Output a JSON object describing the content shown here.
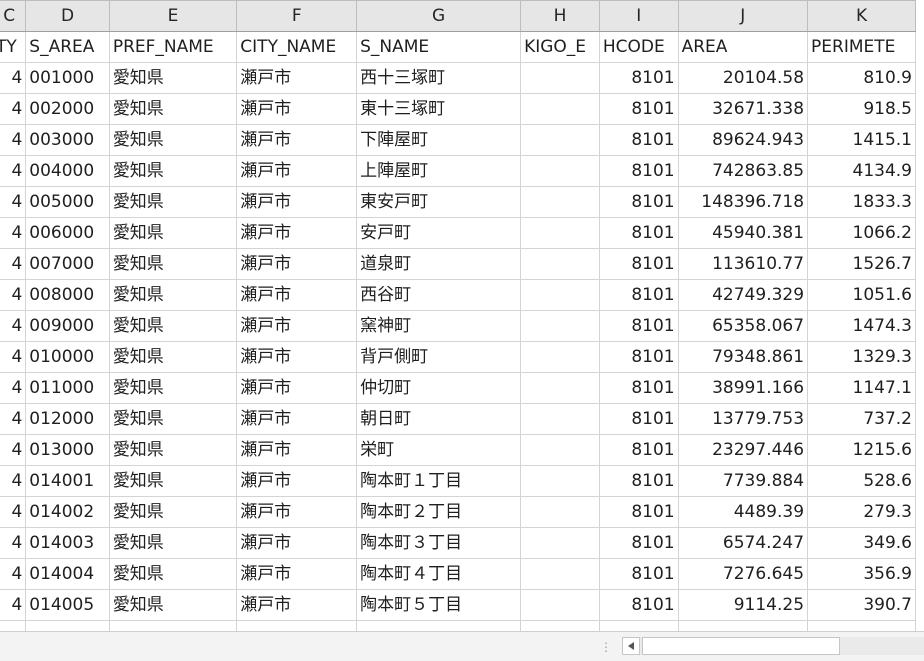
{
  "columns": [
    "C",
    "D",
    "E",
    "F",
    "G",
    "H",
    "I",
    "J",
    "K"
  ],
  "headers": [
    "TY",
    "S_AREA",
    "PREF_NAME",
    "CITY_NAME",
    "S_NAME",
    "KIGO_E",
    "HCODE",
    "AREA",
    "PERIMETE"
  ],
  "rows": [
    {
      "c": "4",
      "s_area": "001000",
      "pref": "愛知県",
      "city": "瀬戸市",
      "s_name": "西十三塚町",
      "kigo": "",
      "hcode": "8101",
      "area": "20104.58",
      "perim": "810.9"
    },
    {
      "c": "4",
      "s_area": "002000",
      "pref": "愛知県",
      "city": "瀬戸市",
      "s_name": "東十三塚町",
      "kigo": "",
      "hcode": "8101",
      "area": "32671.338",
      "perim": "918.5"
    },
    {
      "c": "4",
      "s_area": "003000",
      "pref": "愛知県",
      "city": "瀬戸市",
      "s_name": "下陣屋町",
      "kigo": "",
      "hcode": "8101",
      "area": "89624.943",
      "perim": "1415.1"
    },
    {
      "c": "4",
      "s_area": "004000",
      "pref": "愛知県",
      "city": "瀬戸市",
      "s_name": "上陣屋町",
      "kigo": "",
      "hcode": "8101",
      "area": "742863.85",
      "perim": "4134.9"
    },
    {
      "c": "4",
      "s_area": "005000",
      "pref": "愛知県",
      "city": "瀬戸市",
      "s_name": "東安戸町",
      "kigo": "",
      "hcode": "8101",
      "area": "148396.718",
      "perim": "1833.3"
    },
    {
      "c": "4",
      "s_area": "006000",
      "pref": "愛知県",
      "city": "瀬戸市",
      "s_name": "安戸町",
      "kigo": "",
      "hcode": "8101",
      "area": "45940.381",
      "perim": "1066.2"
    },
    {
      "c": "4",
      "s_area": "007000",
      "pref": "愛知県",
      "city": "瀬戸市",
      "s_name": "道泉町",
      "kigo": "",
      "hcode": "8101",
      "area": "113610.77",
      "perim": "1526.7"
    },
    {
      "c": "4",
      "s_area": "008000",
      "pref": "愛知県",
      "city": "瀬戸市",
      "s_name": "西谷町",
      "kigo": "",
      "hcode": "8101",
      "area": "42749.329",
      "perim": "1051.6"
    },
    {
      "c": "4",
      "s_area": "009000",
      "pref": "愛知県",
      "city": "瀬戸市",
      "s_name": "窯神町",
      "kigo": "",
      "hcode": "8101",
      "area": "65358.067",
      "perim": "1474.3"
    },
    {
      "c": "4",
      "s_area": "010000",
      "pref": "愛知県",
      "city": "瀬戸市",
      "s_name": "背戸側町",
      "kigo": "",
      "hcode": "8101",
      "area": "79348.861",
      "perim": "1329.3"
    },
    {
      "c": "4",
      "s_area": "011000",
      "pref": "愛知県",
      "city": "瀬戸市",
      "s_name": "仲切町",
      "kigo": "",
      "hcode": "8101",
      "area": "38991.166",
      "perim": "1147.1"
    },
    {
      "c": "4",
      "s_area": "012000",
      "pref": "愛知県",
      "city": "瀬戸市",
      "s_name": "朝日町",
      "kigo": "",
      "hcode": "8101",
      "area": "13779.753",
      "perim": "737.2"
    },
    {
      "c": "4",
      "s_area": "013000",
      "pref": "愛知県",
      "city": "瀬戸市",
      "s_name": "栄町",
      "kigo": "",
      "hcode": "8101",
      "area": "23297.446",
      "perim": "1215.6"
    },
    {
      "c": "4",
      "s_area": "014001",
      "pref": "愛知県",
      "city": "瀬戸市",
      "s_name": "陶本町１丁目",
      "kigo": "",
      "hcode": "8101",
      "area": "7739.884",
      "perim": "528.6"
    },
    {
      "c": "4",
      "s_area": "014002",
      "pref": "愛知県",
      "city": "瀬戸市",
      "s_name": "陶本町２丁目",
      "kigo": "",
      "hcode": "8101",
      "area": "4489.39",
      "perim": "279.3"
    },
    {
      "c": "4",
      "s_area": "014003",
      "pref": "愛知県",
      "city": "瀬戸市",
      "s_name": "陶本町３丁目",
      "kigo": "",
      "hcode": "8101",
      "area": "6574.247",
      "perim": "349.6"
    },
    {
      "c": "4",
      "s_area": "014004",
      "pref": "愛知県",
      "city": "瀬戸市",
      "s_name": "陶本町４丁目",
      "kigo": "",
      "hcode": "8101",
      "area": "7276.645",
      "perim": "356.9"
    },
    {
      "c": "4",
      "s_area": "014005",
      "pref": "愛知県",
      "city": "瀬戸市",
      "s_name": "陶本町５丁目",
      "kigo": "",
      "hcode": "8101",
      "area": "9114.25",
      "perim": "390.7"
    },
    {
      "c": "",
      "s_area": "",
      "pref": "",
      "city": "",
      "s_name": "",
      "kigo": "",
      "hcode": "",
      "area": "",
      "perim": ""
    }
  ],
  "bottombar": {
    "split_handle_icon": "vertical-dots-icon",
    "scroll_left_icon": "triangle-left-icon"
  }
}
